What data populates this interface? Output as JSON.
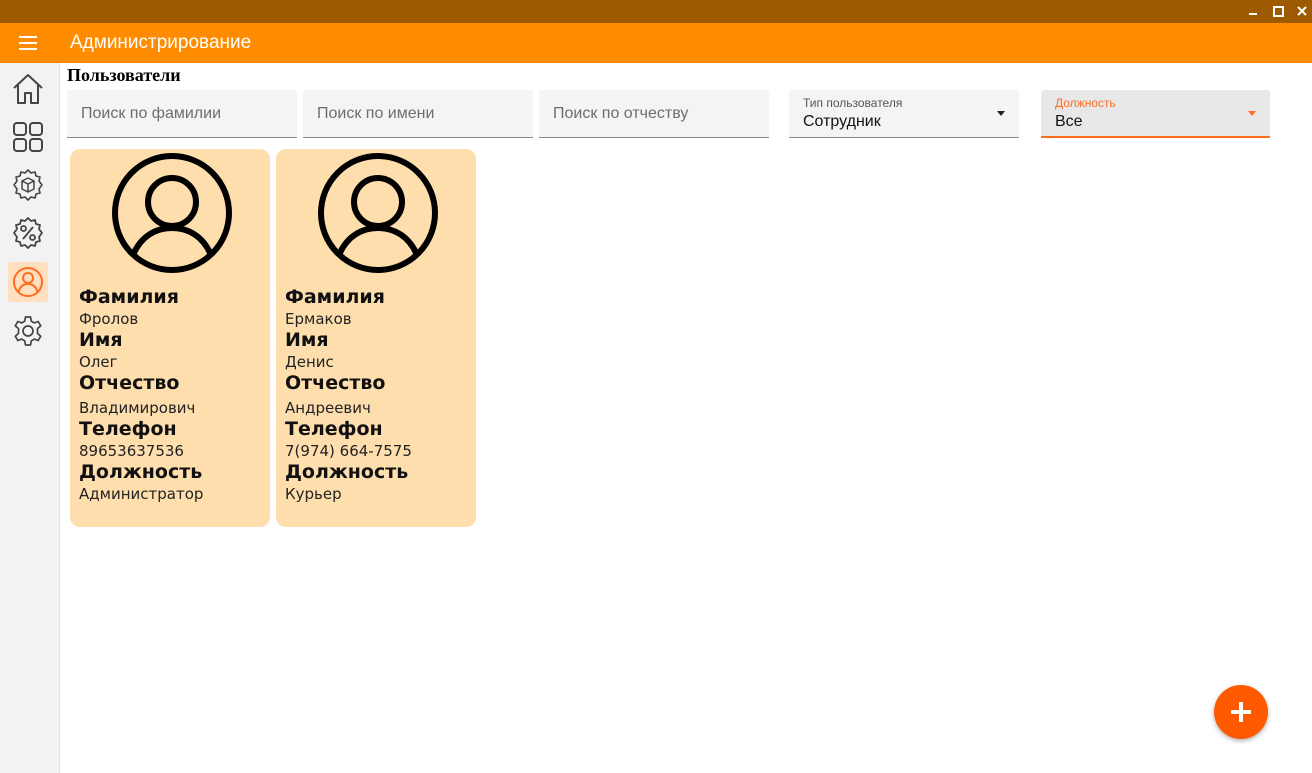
{
  "app": {
    "title": "Администрирование"
  },
  "window": {
    "minimize_icon": "minimize-icon",
    "maximize_icon": "maximize-icon",
    "close_icon": "close-icon"
  },
  "sidebar": {
    "items": [
      {
        "id": "home",
        "icon": "home-icon"
      },
      {
        "id": "dashboard",
        "icon": "grid-icon"
      },
      {
        "id": "products",
        "icon": "box-gear-icon"
      },
      {
        "id": "discounts",
        "icon": "percent-badge-icon"
      },
      {
        "id": "users",
        "icon": "user-circle-icon",
        "active": true
      },
      {
        "id": "settings",
        "icon": "gear-icon"
      }
    ]
  },
  "page": {
    "title": "Пользователи"
  },
  "filters": {
    "surname_placeholder": "Поиск по фамилии",
    "name_placeholder": "Поиск по имени",
    "patronymic_placeholder": "Поиск по отчеству",
    "user_type": {
      "label": "Тип пользователя",
      "value": "Сотрудник"
    },
    "position": {
      "label": "Должность",
      "value": "Все"
    }
  },
  "card_labels": {
    "surname": "Фамилия",
    "name": "Имя",
    "patronymic": "Отчество",
    "phone": "Телефон",
    "position": "Должность"
  },
  "users": [
    {
      "surname": "Фролов",
      "name": "Олег",
      "patronymic": "Владимирович",
      "phone": "89653637536",
      "position": "Администратор"
    },
    {
      "surname": "Ермаков",
      "name": "Денис",
      "patronymic": "Андреевич",
      "phone": "7(974) 664-7575",
      "position": "Курьер"
    }
  ],
  "colors": {
    "titlebar": "#9e5a00",
    "appbar": "#ff8c00",
    "accent": "#ff6d1f",
    "card": "#ffdead",
    "fab": "#ff5a00"
  },
  "fab": {
    "icon": "plus-icon"
  }
}
